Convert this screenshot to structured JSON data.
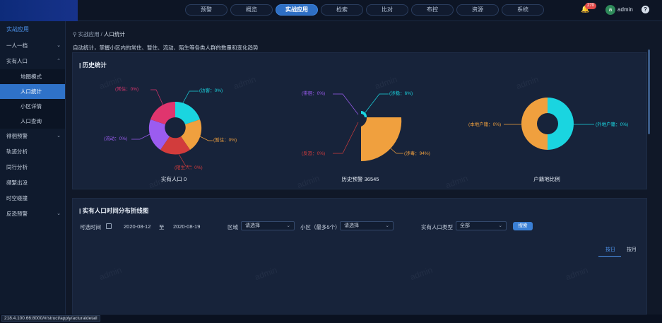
{
  "header": {
    "nav": [
      "预警",
      "概览",
      "实战应用",
      "检索",
      "比对",
      "布控",
      "资源",
      "系统"
    ],
    "active_nav": 2,
    "notification_count": "270",
    "avatar_letter": "a",
    "user": "admin",
    "help": "?"
  },
  "sidebar": {
    "title": "实战应用",
    "items": [
      {
        "label": "一人一档",
        "arrow": "⌄"
      },
      {
        "label": "实有人口",
        "arrow": "⌃"
      }
    ],
    "subitems": [
      "地图模式",
      "人口统计",
      "小区详情",
      "人口查询"
    ],
    "active_sub": 1,
    "items2": [
      {
        "label": "徘徊预警",
        "arrow": "⌄"
      },
      {
        "label": "轨迹分析",
        "arrow": ""
      },
      {
        "label": "同行分析",
        "arrow": ""
      },
      {
        "label": "频繁出没",
        "arrow": ""
      },
      {
        "label": "时空碰撞",
        "arrow": ""
      },
      {
        "label": "反恐预警",
        "arrow": "⌄"
      }
    ]
  },
  "breadcrumb": {
    "parent": "实战应用",
    "sep": " / ",
    "current": "人口统计"
  },
  "description": "自动统计，掌握小区内的常住、暂住、流动、陌生等各类人群的数量和变化趋势",
  "history_panel": {
    "title": "| 历史统计",
    "charts": [
      {
        "caption": "实有人口 0",
        "labels": {
          "top_left": "(常住：0%)",
          "top_right": "(访客：0%)",
          "left": "(流动：0%)",
          "right": "(暂住：0%)",
          "bottom": "(陌生人：0%)"
        },
        "colors": [
          "#1ad5e0",
          "#f0a03e",
          "#d23c3c",
          "#9b5cf0",
          "#e0356e"
        ]
      },
      {
        "caption": "历史预警 36545",
        "labels": {
          "top_left": "(徘徊：0%)",
          "top_right": "(涉稳：6%)",
          "bottom_left": "(反恐：0%)",
          "bottom_right": "(涉毒：94%)"
        },
        "values": {
          "涉稳": 6,
          "涉毒": 94
        },
        "colors": [
          "#1ad5e0",
          "#f0a03e"
        ]
      },
      {
        "caption": "户籍地比例",
        "labels": {
          "left": "(本地户籍：0%)",
          "right": "(外地户籍：0%)"
        },
        "colors": [
          "#f0a03e",
          "#1ad5e0"
        ]
      }
    ]
  },
  "trend_panel": {
    "title": "| 实有人口时间分布折线图",
    "time_label": "可选时间",
    "date_start": "2020-08-12",
    "date_to": "至",
    "date_end": "2020-08-19",
    "area_label": "区域",
    "area_value": "请选择",
    "community_label": "小区（最多5个）",
    "community_value": "请选择",
    "type_label": "实有人口类型",
    "type_value": "全部",
    "search": "搜索",
    "tabs": [
      "按日",
      "按月"
    ]
  },
  "status_url": "218.4.100.66:8000/#/struct/apply/acturaldetail"
}
